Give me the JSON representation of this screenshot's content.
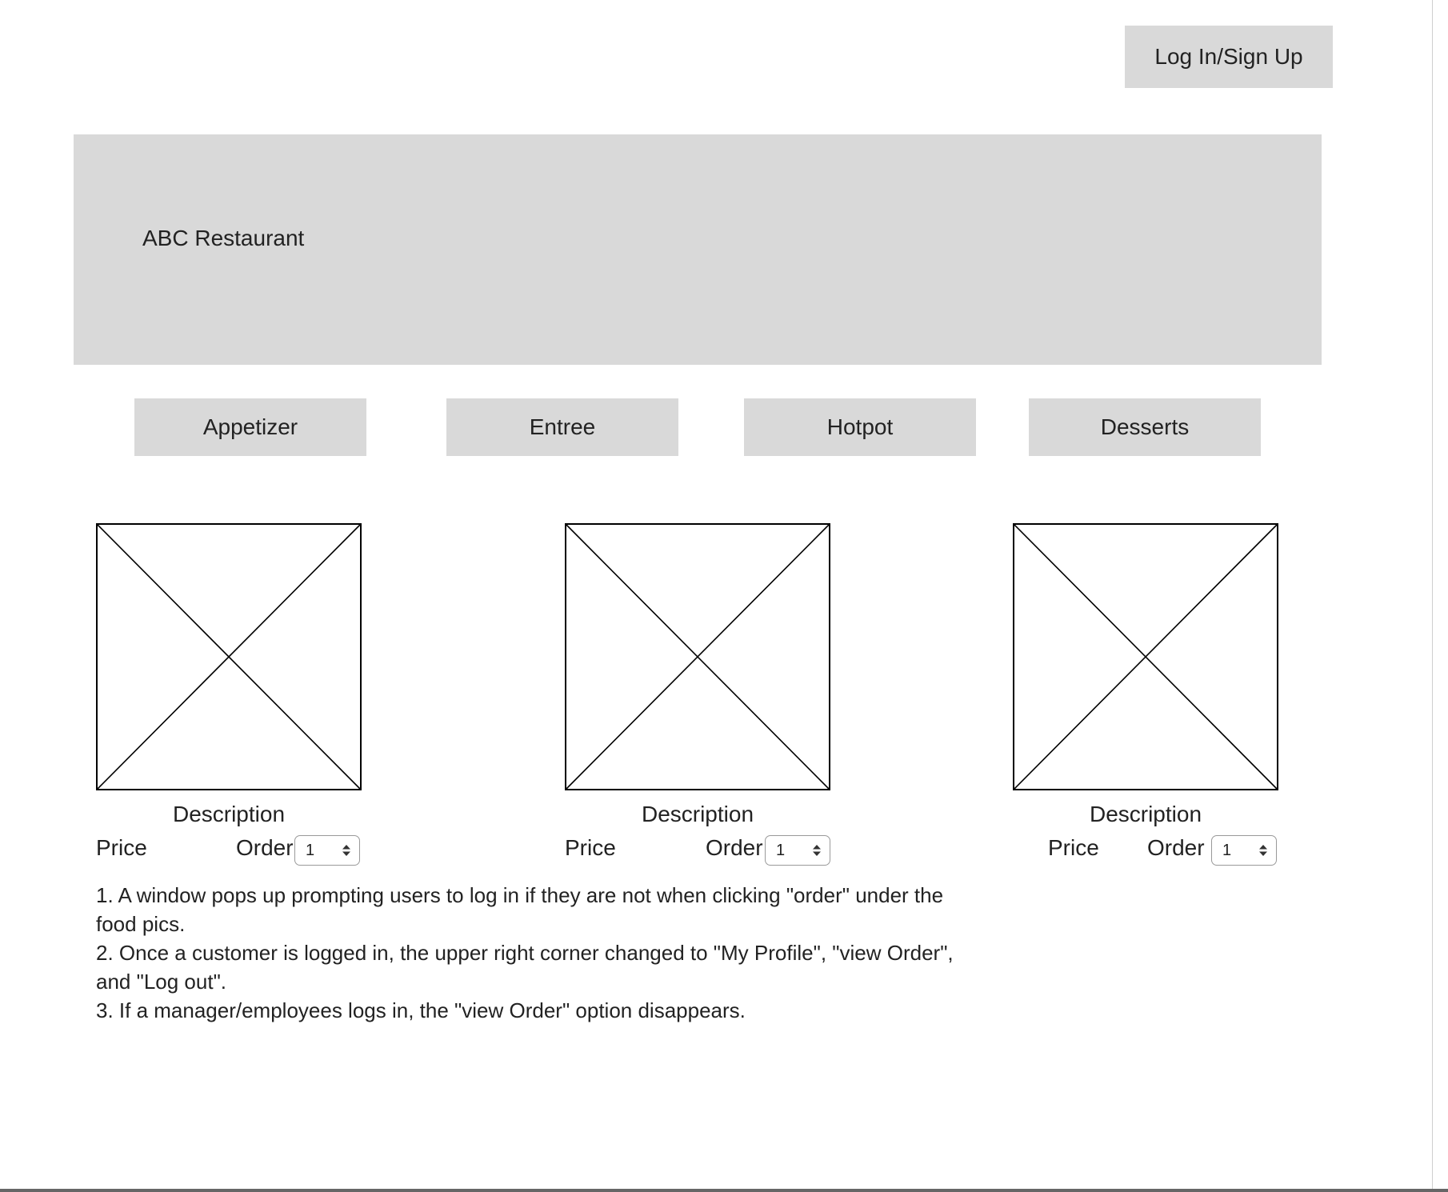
{
  "header": {
    "login_label": "Log In/Sign Up"
  },
  "banner": {
    "title": "ABC Restaurant"
  },
  "categories": [
    {
      "label": "Appetizer"
    },
    {
      "label": "Entree"
    },
    {
      "label": "Hotpot"
    },
    {
      "label": "Desserts"
    }
  ],
  "items": [
    {
      "image_icon": "image-placeholder-icon",
      "description": "Description",
      "price_label": "Price",
      "order_label": "Order",
      "quantity": "1"
    },
    {
      "image_icon": "image-placeholder-icon",
      "description": "Description",
      "price_label": "Price",
      "order_label": "Order",
      "quantity": "1"
    },
    {
      "image_icon": "image-placeholder-icon",
      "description": "Description",
      "price_label": "Price",
      "order_label": "Order",
      "quantity": "1"
    }
  ],
  "notes": [
    "1. A window pops up prompting users to log in if they are not when clicking \"order\" under the food pics.",
    "2. Once a customer is logged in, the upper right corner changed to \"My Profile\", \"view Order\", and \"Log out\".",
    "3. If a manager/employees logs in, the \"view Order\" option disappears."
  ],
  "colors": {
    "button_fill": "#d9d9d9",
    "banner_fill": "#d9d9d9",
    "text": "#222222"
  }
}
